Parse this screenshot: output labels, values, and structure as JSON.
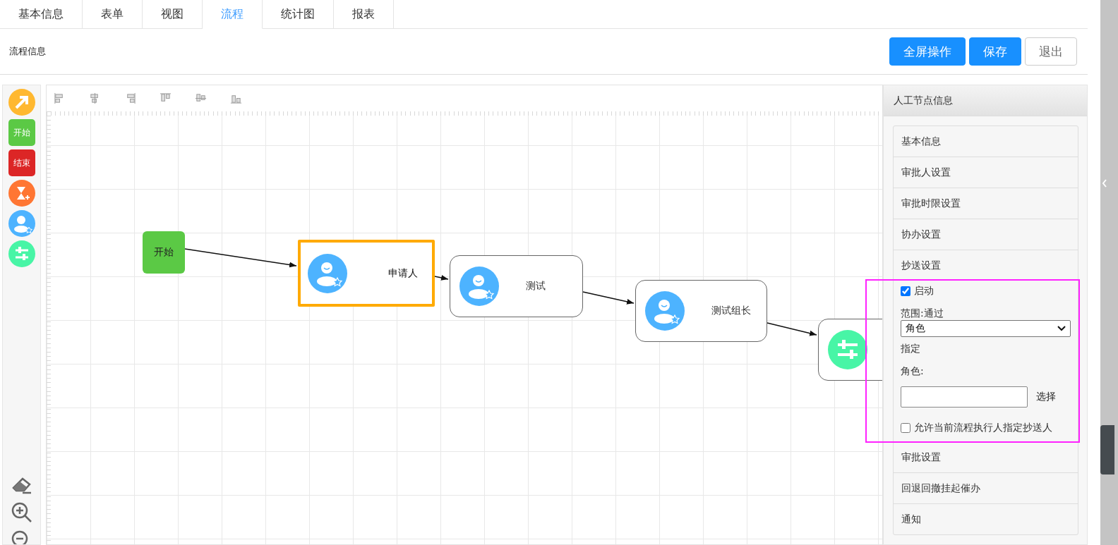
{
  "tabs": [
    {
      "label": "基本信息",
      "selected": false
    },
    {
      "label": "表单",
      "selected": false
    },
    {
      "label": "视图",
      "selected": false
    },
    {
      "label": "流程",
      "selected": true
    },
    {
      "label": "统计图",
      "selected": false
    },
    {
      "label": "报表",
      "selected": false
    }
  ],
  "header": {
    "title": "流程信息",
    "buttons": [
      {
        "label": "全屏操作",
        "kind": "primary"
      },
      {
        "label": "保存",
        "kind": "primary"
      },
      {
        "label": "退出",
        "kind": "default"
      }
    ]
  },
  "palette": [
    {
      "kind": "arrow"
    },
    {
      "kind": "start",
      "label": "开始"
    },
    {
      "kind": "end",
      "label": "结束"
    },
    {
      "kind": "timer"
    },
    {
      "kind": "user"
    },
    {
      "kind": "condition"
    }
  ],
  "nodes": [
    {
      "kind": "start",
      "label": "开始",
      "selected": false
    },
    {
      "kind": "user",
      "label": "申请人",
      "selected": true
    },
    {
      "kind": "user",
      "label": "测试",
      "selected": false
    },
    {
      "kind": "user",
      "label": "测试组长",
      "selected": false
    },
    {
      "kind": "condition",
      "selected": false
    }
  ],
  "panel": {
    "title": "人工节点信息",
    "sections": [
      {
        "label": "基本信息",
        "expanded": false
      },
      {
        "label": "审批人设置",
        "expanded": false
      },
      {
        "label": "审批时限设置",
        "expanded": false
      },
      {
        "label": "协办设置",
        "expanded": false
      },
      {
        "label": "抄送设置",
        "expanded": true
      },
      {
        "label": "审批设置",
        "expanded": false
      },
      {
        "label": "回退回撤挂起催办",
        "expanded": false
      },
      {
        "label": "通知",
        "expanded": false
      }
    ],
    "cc_form": {
      "enable": {
        "label": "启动",
        "checked": true
      },
      "scope_label": "范围:通过",
      "scope_select": "角色",
      "assign_label": "指定",
      "role_label": "角色:",
      "choose_link": "选择",
      "allow": {
        "label": "允许当前流程执行人指定抄送人",
        "checked": false
      }
    }
  }
}
